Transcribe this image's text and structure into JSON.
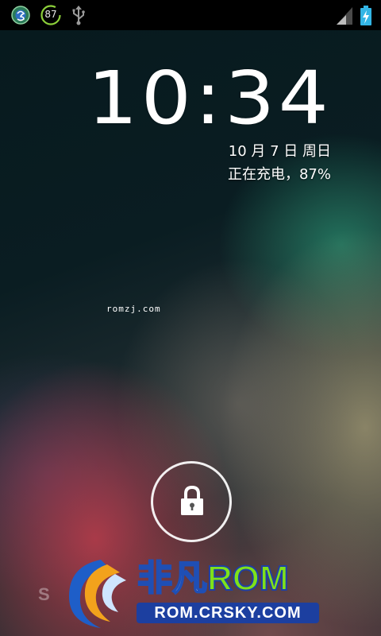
{
  "status_bar": {
    "left_icons": [
      "swirl-app-icon",
      "battery-percent-notification-icon",
      "usb-icon"
    ],
    "battery_notification_value": "87",
    "right_icons": [
      "signal-icon",
      "battery-charging-icon"
    ]
  },
  "lockscreen": {
    "time": "10:34",
    "date": "10 月 7 日 周日",
    "charging_status": "正在充电，87%",
    "carrier_text": "romzj.com",
    "unlock_icon": "lock-icon"
  },
  "watermark": {
    "faint_text": "S",
    "title_cn": "非凡",
    "title_rom": "ROM",
    "url": "ROM.CRSKY.COM"
  },
  "colors": {
    "status_bar_bg": "#000000",
    "brand_green": "#7fe11a",
    "brand_blue": "#1c3fa0"
  }
}
